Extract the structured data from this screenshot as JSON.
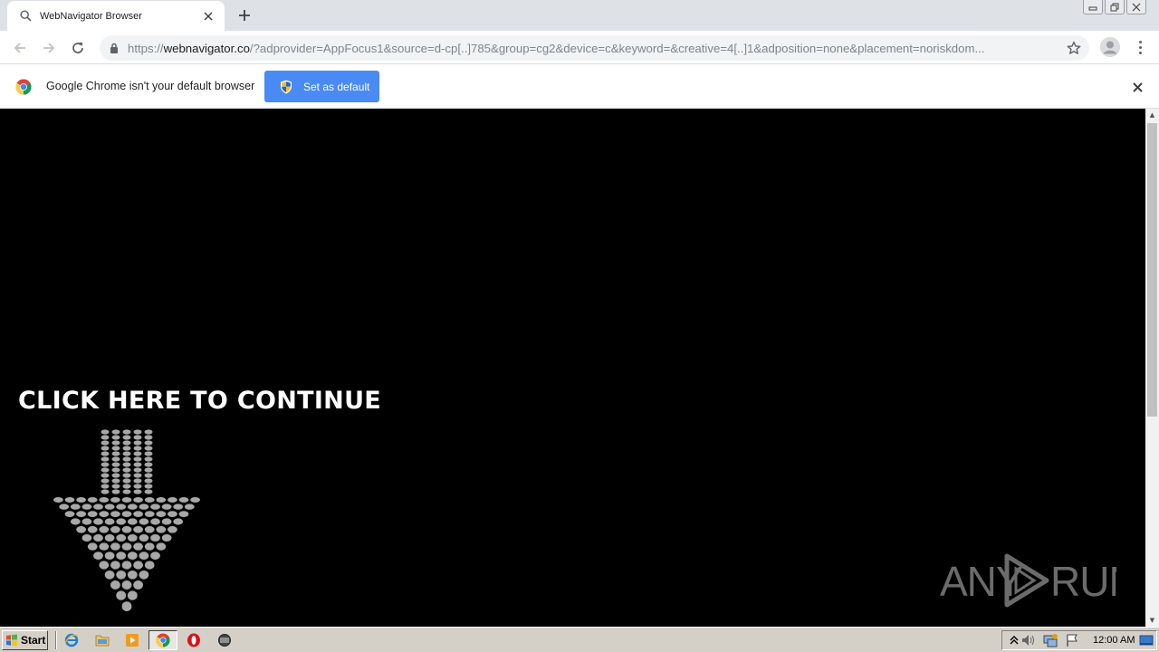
{
  "browser": {
    "tab": {
      "title": "WebNavigator Browser",
      "favicon": "search-icon",
      "close_icon": "close-icon"
    },
    "new_tab_label": "+",
    "url": {
      "scheme": "https://",
      "host": "webnavigator.co",
      "rest": "/?adprovider=AppFocus1&source=d-cp[..]785&group=cg2&device=c&keyword=&creative=4[..]1&adposition=none&placement=noriskdom..."
    },
    "icons": {
      "back": "back-arrow-icon",
      "forward": "forward-arrow-icon",
      "reload": "reload-icon",
      "lock": "lock-icon",
      "star": "star-icon",
      "profile": "profile-icon",
      "menu": "kebab-menu-icon"
    }
  },
  "infobar": {
    "message": "Google Chrome isn't your default browser",
    "button_label": "Set as default",
    "close_label": "✕"
  },
  "page": {
    "cta_text": "CLICK HERE TO CONTINUE",
    "watermark_text": "ANY RUN",
    "background": "#000000"
  },
  "taskbar": {
    "start_label": "Start",
    "clock": "12:00 AM",
    "apps": [
      "internet-explorer-icon",
      "folder-icon",
      "media-player-icon",
      "chrome-icon",
      "opera-icon",
      "generic-app-icon"
    ]
  },
  "colors": {
    "accent": "#4a8af4",
    "tabstrip": "#dee1e6",
    "taskbar": "#d4d0c8"
  }
}
